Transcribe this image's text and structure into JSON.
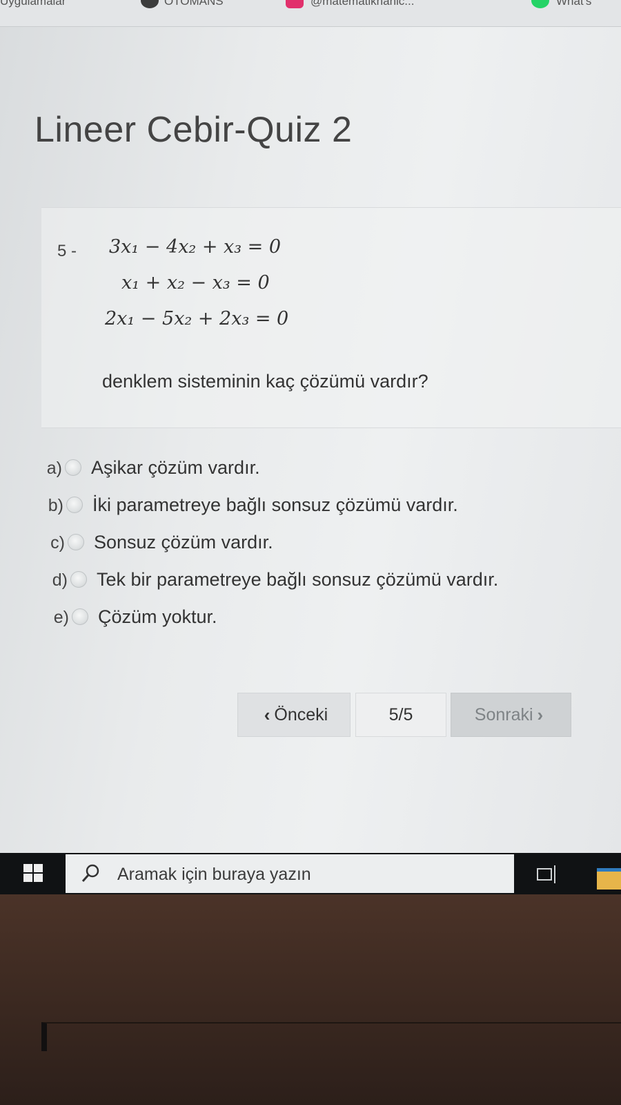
{
  "bookmarks_bar": {
    "items": [
      "Uygulamalar",
      "OTOMANS",
      "@matematikhanic...",
      "What's"
    ],
    "colors": {
      "otomans_icon": "#3c3c3c",
      "instagram_icon": "#e1306c",
      "whatsapp_icon": "#25d366"
    }
  },
  "quiz": {
    "title": "Lineer Cebir-Quiz 2",
    "question": {
      "number": "5 -",
      "equations": [
        "3x₁ − 4x₂ + x₃ = 0",
        "x₁ + x₂ − x₃ = 0",
        "2x₁ − 5x₂ + 2x₃ = 0"
      ],
      "prompt": "denklem sisteminin kaç çözümü vardır?"
    },
    "options": [
      {
        "letter": "a)",
        "text": "Aşikar çözüm vardır."
      },
      {
        "letter": "b)",
        "text": "İki parametreye bağlı sonsuz çözümü vardır."
      },
      {
        "letter": "c)",
        "text": "Sonsuz çözüm vardır."
      },
      {
        "letter": "d)",
        "text": "Tek bir parametreye bağlı sonsuz çözümü vardır."
      },
      {
        "letter": "e)",
        "text": "Çözüm yoktur."
      }
    ],
    "navigation": {
      "prev_label": "Önceki",
      "page_indicator": "5/5",
      "next_label": "Sonraki"
    }
  },
  "taskbar": {
    "search_placeholder": "Aramak için buraya yazın"
  }
}
